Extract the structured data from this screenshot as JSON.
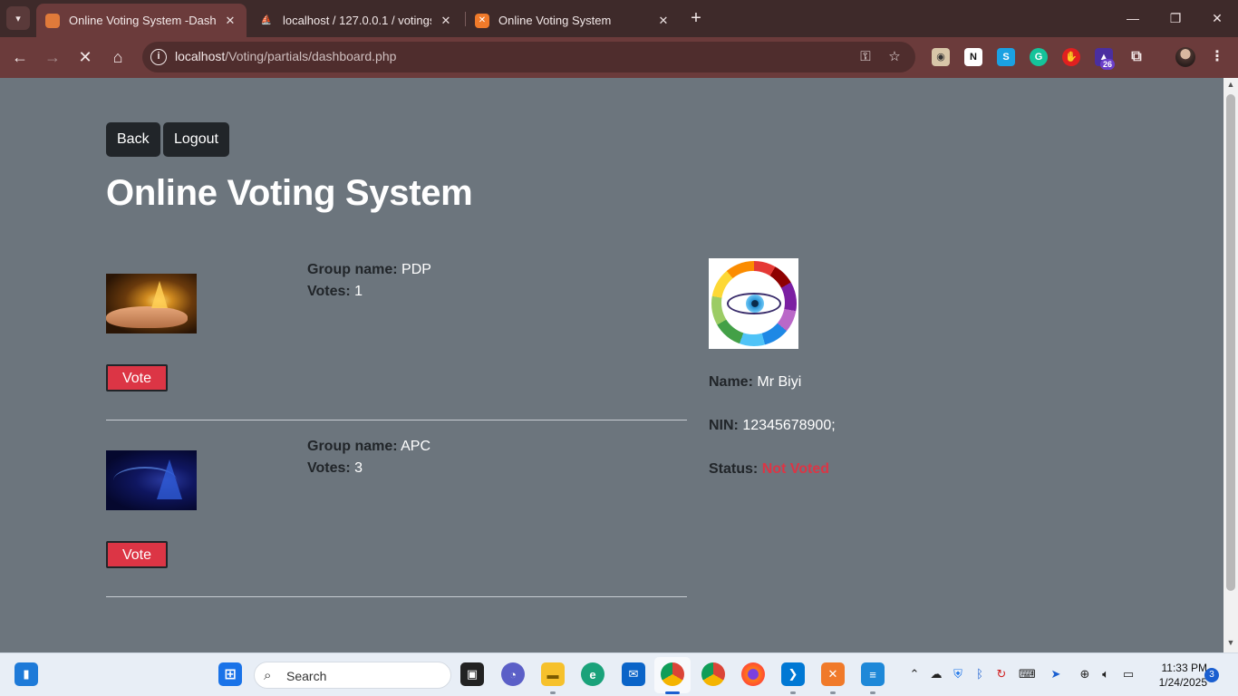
{
  "browser": {
    "tabs": [
      {
        "title": "Online Voting System -Dashboard",
        "active": true
      },
      {
        "title": "localhost / 127.0.0.1 / votingsys",
        "active": false
      },
      {
        "title": "Online Voting System",
        "active": false
      }
    ],
    "url_host": "localhost",
    "url_path": "/Voting/partials/dashboard.php",
    "extension_badge": "26"
  },
  "page": {
    "back_label": "Back",
    "logout_label": "Logout",
    "title": "Online Voting System",
    "groups": [
      {
        "name_label": "Group name:",
        "name": "PDP",
        "votes_label": "Votes:",
        "votes": "1",
        "vote_button": "Vote"
      },
      {
        "name_label": "Group name:",
        "name": "APC",
        "votes_label": "Votes:",
        "votes": "3",
        "vote_button": "Vote"
      }
    ],
    "user": {
      "name_label": "Name:",
      "name": "Mr Biyi",
      "nin_label": "NIN:",
      "nin": "12345678900;",
      "status_label": "Status:",
      "status": "Not Voted"
    }
  },
  "taskbar": {
    "search_placeholder": "Search",
    "time": "11:33 PM",
    "date": "1/24/2025",
    "notifications": "3"
  },
  "colors": {
    "page_bg": "#6c757d",
    "dark_button": "#212529",
    "danger": "#dc3545",
    "tab_bar": "#3e2a2a",
    "toolbar": "#6b3b3b"
  }
}
